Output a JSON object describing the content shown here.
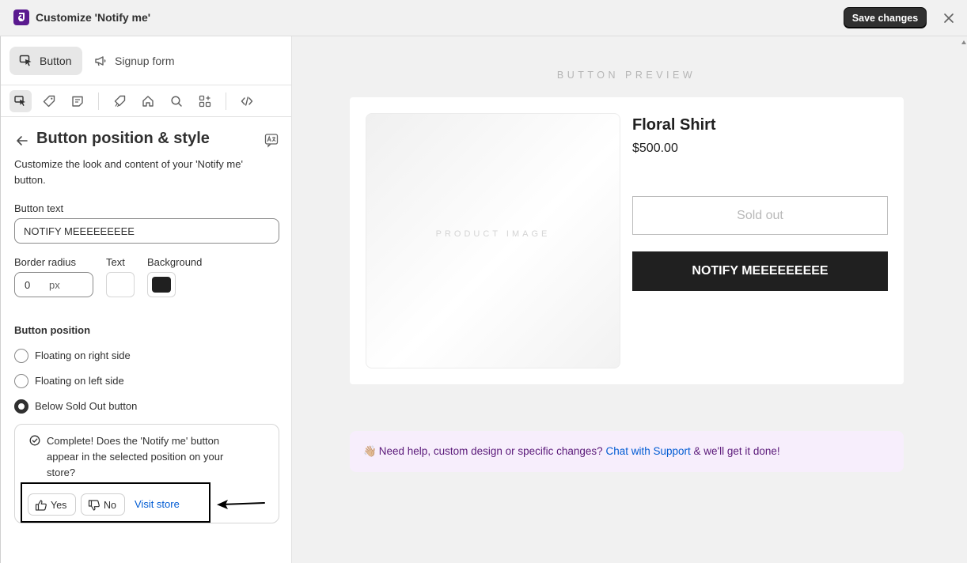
{
  "window": {
    "title": "Customize 'Notify me'",
    "save_label": "Save changes"
  },
  "sidebar": {
    "tabs": [
      {
        "label": "Button",
        "icon": "cursor-click-icon",
        "active": true
      },
      {
        "label": "Signup form",
        "icon": "megaphone-icon",
        "active": false
      }
    ],
    "toolbar_icons": [
      "cursor-click-icon",
      "tag-icon",
      "note-icon",
      "badge-tag-icon",
      "home-icon",
      "search-icon",
      "apps-add-icon",
      "code-icon"
    ],
    "panel": {
      "title": "Button position & style",
      "description": "Customize the look and content of your 'Notify me' button.",
      "button_text_label": "Button text",
      "button_text_value": "NOTIFY MEEEEEEEEE",
      "border_radius_label": "Border radius",
      "border_radius_value": "0",
      "border_radius_unit": "px",
      "text_color_label": "Text",
      "text_color": "#ffffff",
      "background_label": "Background",
      "background_color": "#202020",
      "position_label": "Button position",
      "positions": [
        {
          "label": "Floating on right side",
          "checked": false
        },
        {
          "label": "Floating on left side",
          "checked": false
        },
        {
          "label": "Below Sold Out button",
          "checked": true
        }
      ],
      "feedback": {
        "text": "Complete! Does the 'Notify me' button appear in the selected position on your store?",
        "yes_label": "Yes",
        "no_label": "No",
        "visit_label": "Visit store"
      }
    }
  },
  "preview": {
    "heading": "BUTTON PREVIEW",
    "image_label": "PRODUCT IMAGE",
    "product_name": "Floral Shirt",
    "price": "$500.00",
    "sold_out_label": "Sold out",
    "notify_label": "NOTIFY MEEEEEEEEE",
    "help": {
      "emoji": "👋🏼",
      "prefix": "Need help, custom design or specific changes?",
      "link": "Chat with Support",
      "suffix": "& we'll get it done!"
    }
  },
  "colors": {
    "brand": "#5a1a8f",
    "link": "#005bd3",
    "banner_bg": "#f7eefc",
    "banner_text": "#5b1a7a"
  }
}
